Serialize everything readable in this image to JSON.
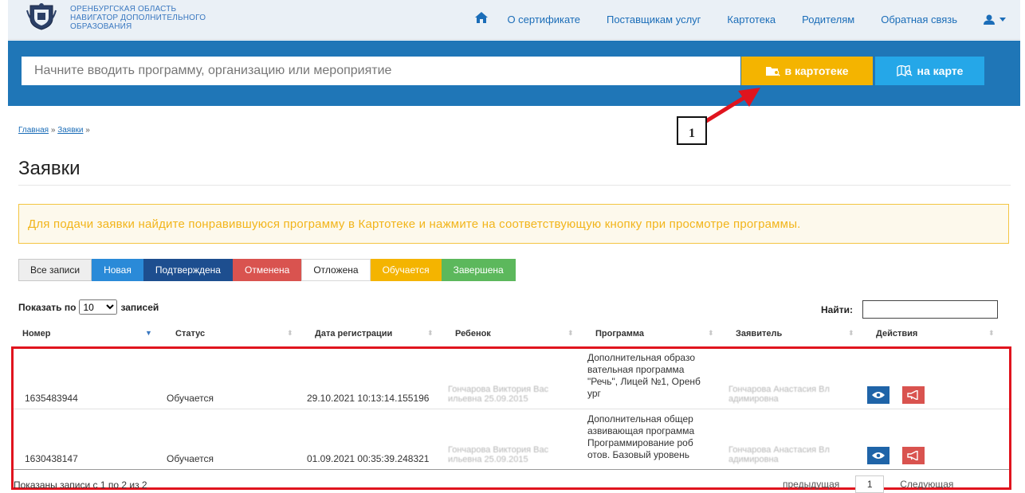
{
  "header": {
    "brand_lines": [
      "ОРЕНБУРГСКАЯ ОБЛАСТЬ",
      "НАВИГАТОР ДОПОЛНИТЕЛЬНОГО",
      "ОБРАЗОВАНИЯ"
    ],
    "home_icon": "home-icon",
    "nav": [
      "О сертификате",
      "Поставщикам услуг",
      "Картотека",
      "Родителям",
      "Обратная связь"
    ],
    "user_icon": "user-icon"
  },
  "search": {
    "placeholder": "Начните вводить программу, организацию или мероприятие",
    "catalog_button": "в картотеке",
    "map_button": "на карте"
  },
  "annotation": {
    "label": "1",
    "color": "#e0141e"
  },
  "breadcrumb": {
    "items": [
      "Главная",
      "Заявки"
    ],
    "separator": "»"
  },
  "page_title": "Заявки",
  "notice": "Для подачи заявки найдите понравившуюся программу в Картотеке и нажмите на соответствующую кнопку при просмотре программы.",
  "filters": [
    "Все записи",
    "Новая",
    "Подтверждена",
    "Отменена",
    "Отложена",
    "Обучается",
    "Завершена"
  ],
  "table_controls": {
    "show_prefix": "Показать по",
    "show_value": "10",
    "show_suffix": "записей",
    "find_label": "Найти:"
  },
  "columns": [
    "Номер",
    "Статус",
    "Дата регистрации",
    "Ребенок",
    "Программа",
    "Заявитель",
    "Действия"
  ],
  "rows": [
    {
      "number": "1635483944",
      "status": "Обучается",
      "date": "29.10.2021 10:13:14.155196",
      "child": "Гончарова Виктория Вас ильевна 25.09.2015",
      "program": "Дополнительная образо вательная программа \"Речь\", Лицей №1, Оренб ург",
      "applicant": "Гончарова Анастасия Вл адимировна"
    },
    {
      "number": "1630438147",
      "status": "Обучается",
      "date": "01.09.2021 00:35:39.248321",
      "child": "Гончарова Виктория Вас ильевна 25.09.2015",
      "program": "Дополнительная общер азвивающая программа Программирование роб отов. Базовый уровень",
      "applicant": "Гончарова Анастасия Вл адимировна"
    }
  ],
  "footer": {
    "info": "Показаны записи с 1 по 2 из 2",
    "prev": "предыдущая",
    "page": "1",
    "next": "Следующая"
  }
}
